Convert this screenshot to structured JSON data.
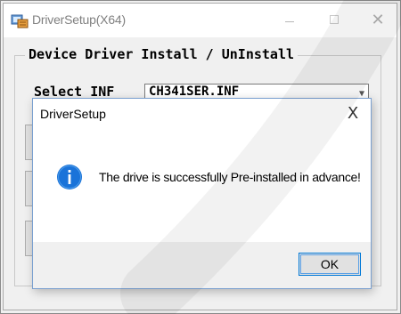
{
  "main_window": {
    "title": "DriverSetup(X64)",
    "group_title": "Device Driver Install / UnInstall",
    "select_inf_label": "Select INF",
    "inf_value": "CH341SER.INF"
  },
  "dialog": {
    "title": "DriverSetup",
    "message": "The drive is successfully Pre-installed in advance!",
    "ok_label": "OK",
    "close_glyph": "X"
  },
  "colors": {
    "info_icon": "#1a73d9",
    "ok_focus_border": "#0078d7",
    "watermark": "#000000"
  }
}
